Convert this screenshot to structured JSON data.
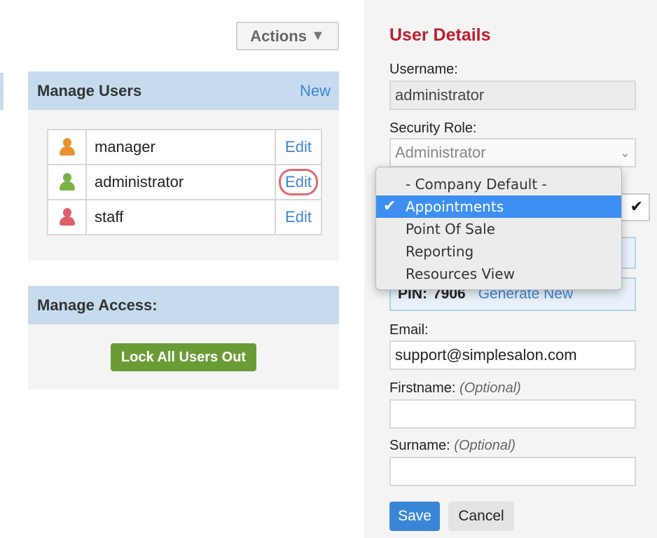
{
  "toolbar": {
    "actions_label": "Actions",
    "actions_caret": "▼"
  },
  "manage_users": {
    "title": "Manage Users",
    "new_label": "New",
    "users": [
      {
        "name": "manager",
        "edit_label": "Edit",
        "icon": "user-icon",
        "icon_color": "#e8922f"
      },
      {
        "name": "administrator",
        "edit_label": "Edit",
        "icon": "user-icon",
        "icon_color": "#7cb24a"
      },
      {
        "name": "staff",
        "edit_label": "Edit",
        "icon": "user-icon",
        "icon_color": "#e0606a"
      }
    ]
  },
  "manage_access": {
    "title": "Manage Access:",
    "lock_button_label": "Lock All Users Out"
  },
  "user_details": {
    "title": "User Details",
    "username_label": "Username:",
    "username_value": "administrator",
    "security_role_label": "Security Role:",
    "security_role_value": "Administrator",
    "pin_label": "PIN:",
    "pin_value": "7906",
    "generate_new_label": "Generate New",
    "email_label": "Email:",
    "email_value": "support@simplesalon.com",
    "firstname_label": "Firstname:",
    "firstname_optional": "(Optional)",
    "firstname_value": "",
    "surname_label": "Surname:",
    "surname_optional": "(Optional)",
    "surname_value": "",
    "save_label": "Save",
    "cancel_label": "Cancel"
  },
  "dropdown": {
    "options": [
      "- Company Default -",
      "Appointments",
      "Point Of Sale",
      "Reporting",
      "Resources View"
    ],
    "selected": "Appointments",
    "check_glyph": "✔",
    "selected_color": "#3d90f2"
  },
  "colors": {
    "accent_blue": "#3a86d6",
    "title_red": "#be1e2d",
    "header_bg": "#c6dcee",
    "lock_green": "#6a9c36"
  }
}
